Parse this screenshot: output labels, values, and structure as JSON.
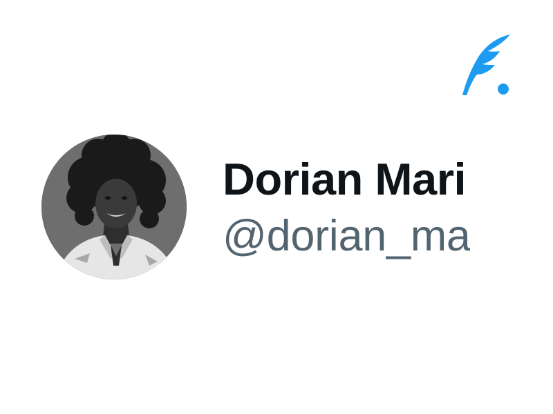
{
  "colors": {
    "accent": "#1d9bf0",
    "name_text": "#0f1419",
    "handle_text": "#536471",
    "background": "#ffffff"
  },
  "brand": {
    "icon": "feather-quill-icon"
  },
  "profile": {
    "avatar_icon": "profile-photo",
    "display_name": "Dorian Mari",
    "handle": "@dorian_ma"
  }
}
